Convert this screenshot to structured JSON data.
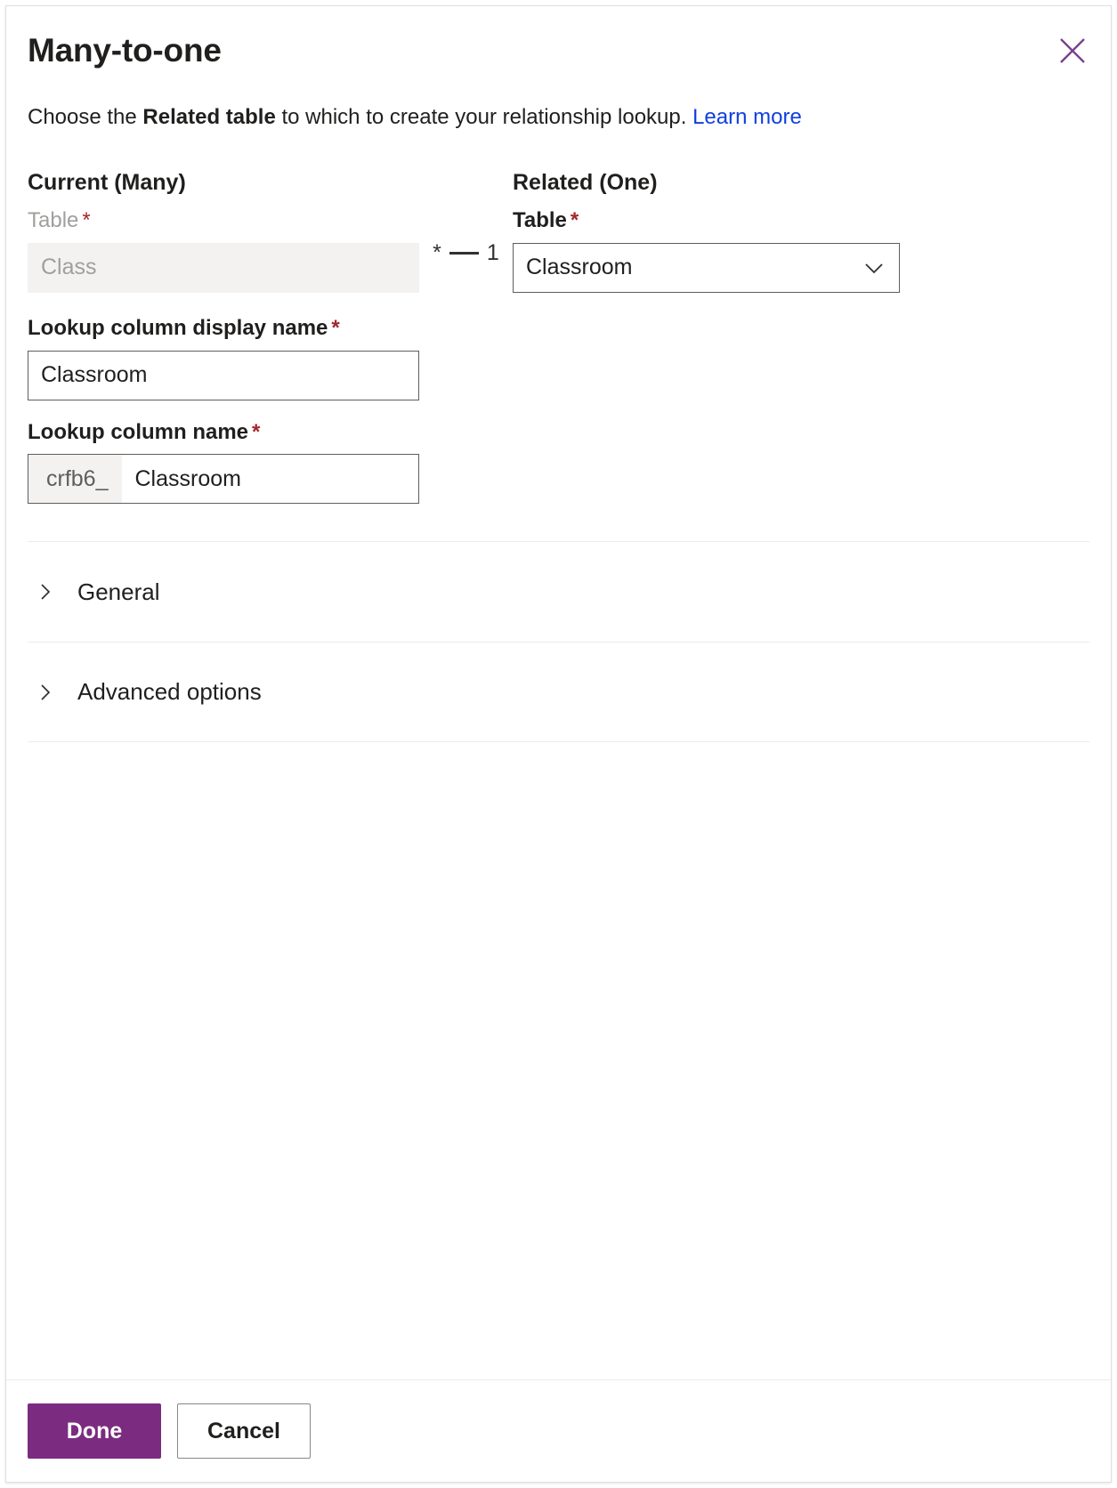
{
  "dialog": {
    "title": "Many-to-one",
    "close_icon": "close-icon",
    "description_prefix": "Choose the ",
    "description_bold": "Related table",
    "description_suffix": " to which to create your relationship lookup. ",
    "learn_more_label": "Learn more"
  },
  "current_section": {
    "heading": "Current (Many)",
    "table_label": "Table",
    "table_required": "*",
    "table_value": "Class"
  },
  "relationship_indicator": {
    "many_symbol": "*",
    "one_symbol": "1"
  },
  "related_section": {
    "heading": "Related (One)",
    "table_label": "Table",
    "table_required": "*",
    "table_value": "Classroom",
    "dropdown_icon": "chevron-down-icon"
  },
  "lookup_display_name": {
    "label": "Lookup column display name",
    "required": "*",
    "value": "Classroom"
  },
  "lookup_name": {
    "label": "Lookup column name",
    "required": "*",
    "prefix": "crfb6_",
    "value": "Classroom"
  },
  "accordions": [
    {
      "label": "General",
      "icon": "chevron-right-icon",
      "expanded": false
    },
    {
      "label": "Advanced options",
      "icon": "chevron-right-icon",
      "expanded": false
    }
  ],
  "footer": {
    "done_label": "Done",
    "cancel_label": "Cancel"
  },
  "colors": {
    "primary_button": "#7b2c80",
    "link": "#0f3fe0",
    "required_asterisk": "#a4262c",
    "close_icon": "#7b3f8f",
    "disabled_field_bg": "#f3f2f1",
    "border": "#605e5c"
  }
}
